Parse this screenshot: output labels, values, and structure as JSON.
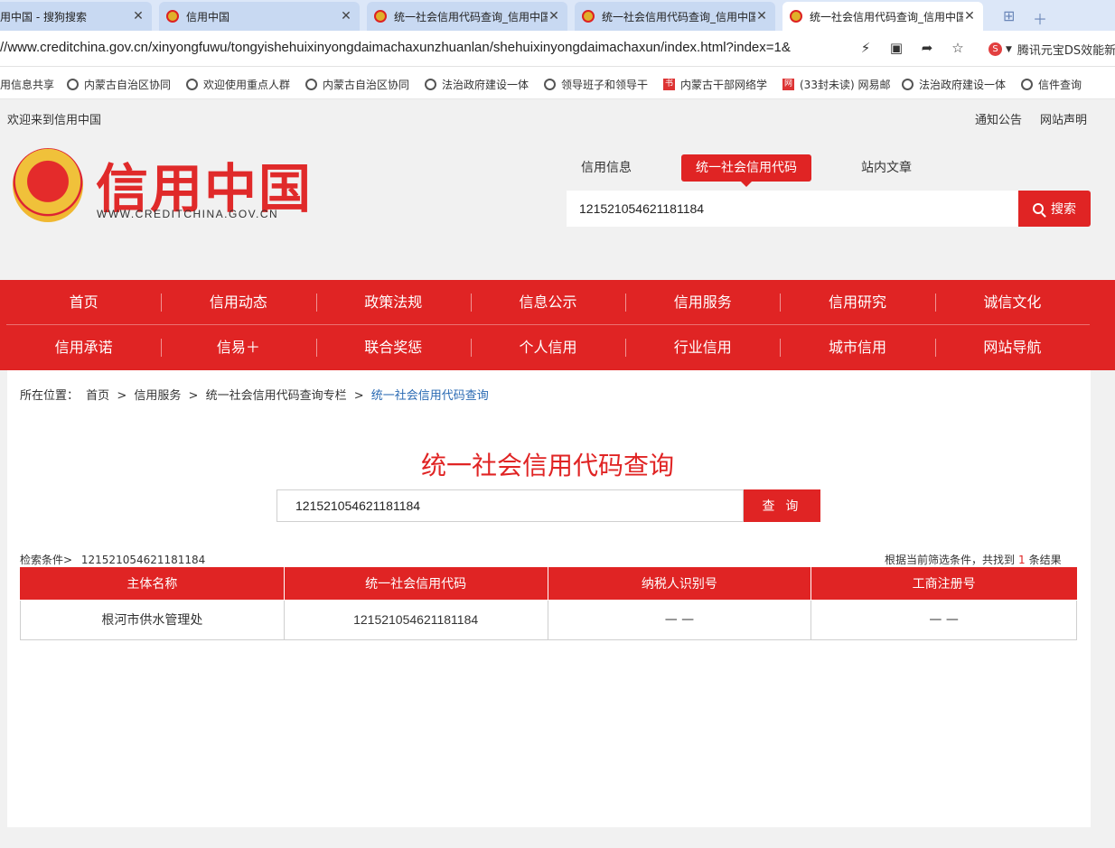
{
  "browser": {
    "tabs": [
      {
        "title": "用中国 - 搜狗搜索",
        "active": false
      },
      {
        "title": "信用中国",
        "active": false
      },
      {
        "title": "统一社会信用代码查询_信用中国",
        "active": false
      },
      {
        "title": "统一社会信用代码查询_信用中国",
        "active": false
      },
      {
        "title": "统一社会信用代码查询_信用中国",
        "active": true
      }
    ],
    "url": "//www.creditchina.gov.cn/xinyongfuwu/tongyishehuixinyongdaimachaxunzhuanlan/shehuixinyongdaimachaxun/index.html?index=1&",
    "extension_label": "腾讯元宝DS效能新",
    "bookmarks": [
      "用信息共享",
      "内蒙古自治区协同",
      "欢迎使用重点人群",
      "内蒙古自治区协同",
      "法治政府建设一体",
      "领导班子和领导干",
      "内蒙古干部网络学",
      "(33封未读) 网易邮",
      "法治政府建设一体",
      "信件查询"
    ]
  },
  "site": {
    "welcome": "欢迎来到信用中国",
    "top_links": [
      "通知公告",
      "网站声明"
    ],
    "logo_title": "信用中国",
    "logo_sub": "WWW.CREDITCHINA.GOV.CN",
    "search_tabs": [
      "信用信息",
      "统一社会信用代码",
      "站内文章"
    ],
    "search_value": "121521054621181184",
    "search_button": "搜索",
    "nav_row1": [
      "首页",
      "信用动态",
      "政策法规",
      "信息公示",
      "信用服务",
      "信用研究",
      "诚信文化"
    ],
    "nav_row2": [
      "信用承诺",
      "信易＋",
      "联合奖惩",
      "个人信用",
      "行业信用",
      "城市信用",
      "网站导航"
    ]
  },
  "content": {
    "breadcrumb": {
      "label": "所在位置：",
      "items": [
        "首页",
        "信用服务",
        "统一社会信用代码查询专栏",
        "统一社会信用代码查询"
      ],
      "separator": ">"
    },
    "page_title": "统一社会信用代码查询",
    "query_value": "121521054621181184",
    "query_button": "查 询",
    "condition_label": "检索条件>",
    "condition_value": "121521054621181184",
    "result_prefix": "根据当前筛选条件，共找到",
    "result_count": "1",
    "result_suffix": "条结果",
    "table": {
      "headers": [
        "主体名称",
        "统一社会信用代码",
        "纳税人识别号",
        "工商注册号"
      ],
      "rows": [
        [
          "根河市供水管理处",
          "121521054621181184",
          "— —",
          "— —"
        ]
      ]
    }
  },
  "colors": {
    "brand_red": "#e02424",
    "link_blue": "#2a6ab3"
  }
}
